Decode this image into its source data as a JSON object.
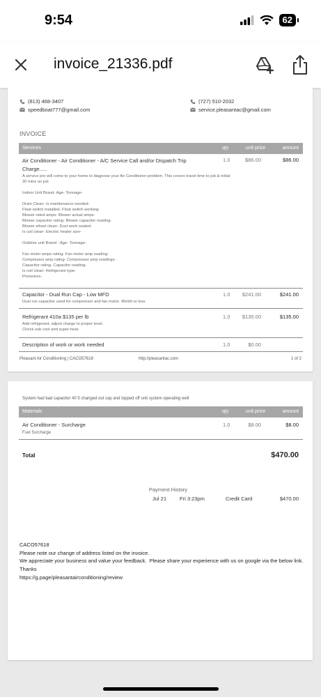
{
  "status_bar": {
    "time": "9:54",
    "battery": "62"
  },
  "toolbar": {
    "title": "invoice_21336.pdf"
  },
  "page1": {
    "left_phone": "(813) 468-3407",
    "left_email": "speedboat777@gmail.com",
    "right_phone": "(727) 510-2032",
    "right_email": "service.pleasantac@gmail.com",
    "section_title": "INVOICE",
    "columns": {
      "services": "Services",
      "qty": "qty",
      "unit_price": "unit price",
      "amount": "amount"
    },
    "items": [
      {
        "title": "Air Conditioner - Air Conditioner - A/C Service Call and/or Dispatch Trip Charge.....",
        "qty": "1.0",
        "unit_price": "$86.00",
        "amount": "$86.00",
        "description": "A service pro will come to your home to diagnose your Air Conditioner problem. This covers travel time to job & initial\n30 mins on job\n\nIndoor Unit Brand- Age- Tonnage-\n\nDrain Clean- Is maintenance needed-\nFloat switch installed- Float switch working-\nBlower rated amps- Blower actual amps-\nBlower capacitor rating- Blower capacitor reading-\nBlower wheel clean- Duct work sealed-\nIs coil clean- Electric heater size-\n\nOutdoor unit Brand - Age- Tonnage-\n\nFan motor amps rating- Fan motor amp reading-\nCompressor amp rating- Compressor amp readings-\nCapacitor rating- Capacitor reading-\nIs coil clean- Refrigerant type-\nPressures-"
      },
      {
        "title": "Capacitor - Dual Run Cap - Low MFD",
        "qty": "1.0",
        "unit_price": "$241.00",
        "amount": "$241.00",
        "description": "Dual run capacitor used for compressor and fan motor. 45mfd or less"
      },
      {
        "title": "Refrigerant 410a $135 per lb",
        "qty": "1.0",
        "unit_price": "$135.00",
        "amount": "$135.00",
        "description": "Add refrigerant, adjust charge to proper level.\nCheck sub cool and super-heat."
      },
      {
        "title": "Description of work or work needed",
        "qty": "1.0",
        "unit_price": "$0.00",
        "amount": "",
        "description": ""
      }
    ],
    "footer_company": "Pleasant Air Conditioning | CACO57618",
    "footer_url": "http://pleasantac.com",
    "footer_page": "1 of 2"
  },
  "page2": {
    "note": "System had bad capacitor 40 5 changed out cap and topped off unit system operating well",
    "columns": {
      "materials": "Materials",
      "qty": "qty",
      "unit_price": "unit price",
      "amount": "amount"
    },
    "material": {
      "title": "Air Conditioner - Surcharge",
      "subtitle": "Fuel Surcharge",
      "qty": "1.0",
      "unit_price": "$8.00",
      "amount": "$8.00"
    },
    "total_label": "Total",
    "total_value": "$470.00",
    "payment_history_title": "Payment History",
    "payment": {
      "date": "Jul 21",
      "time": "Fri 3:23pm",
      "method": "Credit Card",
      "amount": "$470.00"
    },
    "closing_note": "CACO57618\nPlease note our change of address listed on the invoice.\nWe appreciate your business and value your feedback.  Please share your experience with us on google via the below link.  Thanks\nhttps://g.page/pleasantairconditioning/review"
  },
  "icons": {
    "close": "close-icon",
    "drive": "add-to-drive-icon",
    "share": "share-icon",
    "phone": "phone-icon",
    "email": "email-icon"
  }
}
